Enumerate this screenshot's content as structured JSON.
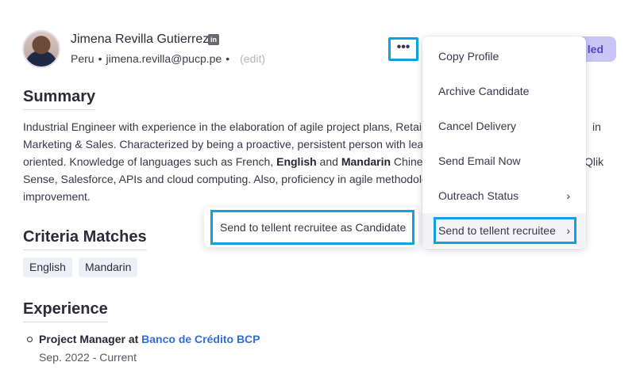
{
  "profile": {
    "name": "Jimena Revilla Gutierrez",
    "linkedin_icon": "in",
    "location": "Peru",
    "email": "jimena.revilla@pucp.pe",
    "edit_label": "(edit)",
    "status_visible": "led"
  },
  "kebab": {
    "label": "•••"
  },
  "summary": {
    "heading": "Summary",
    "p1": "Industrial Engineer with experience in the elaboration of agile project plans, Retail",
    "p1_tail": "in",
    "p2": "Marketing & Sales. Characterized by being a proactive, persistent person with lead",
    "p3a": "oriented. Knowledge of languages such as French, ",
    "p3_english": "English",
    "p3b": " and ",
    "p3_mandarin": "Mandarin",
    "p3c": " Chinese",
    "p3_tail": "Qlik",
    "p4": "Sense, Salesforce, APIs and cloud computing. Also, proficiency in agile methodolo",
    "p5": "improvement."
  },
  "criteria": {
    "heading": "Criteria Matches",
    "chips": [
      "English",
      "Mandarin"
    ]
  },
  "experience": {
    "heading": "Experience",
    "role": "Project Manager at ",
    "company": "Banco de Crédito BCP",
    "dates": "Sep. 2022 - Current"
  },
  "menu": {
    "items": [
      "Copy Profile",
      "Archive Candidate",
      "Cancel Delivery",
      "Send Email Now",
      "Outreach Status",
      "Send to tellent recruitee"
    ],
    "chevron": "›"
  },
  "submenu": {
    "item": "Send to tellent recruitee as Candidate"
  }
}
